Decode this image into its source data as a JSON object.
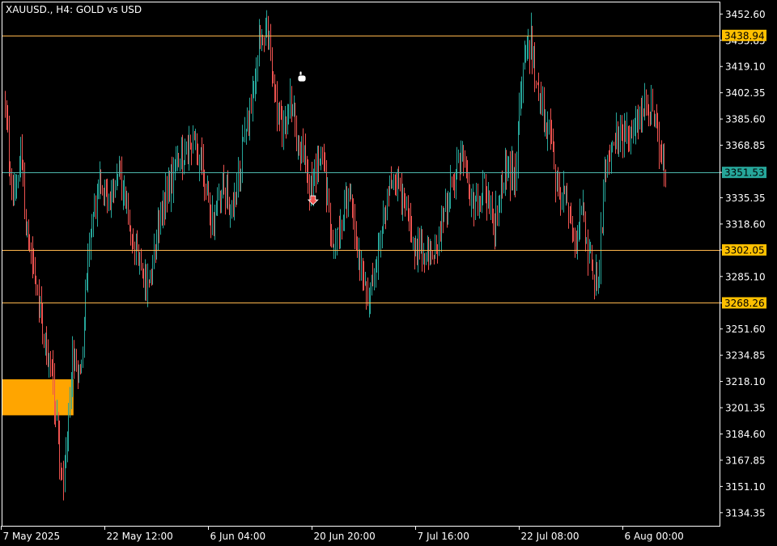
{
  "window": {
    "symbol_title": "XAUUSD., H4:  GOLD vs USD"
  },
  "colors": {
    "background": "#000000",
    "frame": "#ffffff",
    "bull": "#26a69a",
    "bear": "#ef5350",
    "level_line": "#ffb74d",
    "bid_line": "#4db6ac",
    "level_badge": "#ffc000",
    "bid_badge": "#26a69a",
    "zone": "#ffa500"
  },
  "chart_data": {
    "type": "candlestick",
    "ylim": [
      3126.0,
      3460.0
    ],
    "y_ticks": [
      "3452.60",
      "3435.85",
      "3419.10",
      "3402.35",
      "3385.60",
      "3368.85",
      "3351.53",
      "3335.35",
      "3318.60",
      "3302.05",
      "3285.10",
      "3268.26",
      "3251.60",
      "3234.85",
      "3218.10",
      "3201.35",
      "3184.60",
      "3167.85",
      "3151.10",
      "3134.35"
    ],
    "x_tick_labels": [
      "7 May 2025",
      "22 May 12:00",
      "6 Jun 04:00",
      "20 Jun 20:00",
      "7 Jul 16:00",
      "22 Jul 08:00",
      "6 Aug 00:00"
    ],
    "bar_count": 550,
    "x_tick_bar_index": [
      0,
      80,
      160,
      240,
      320,
      400,
      480
    ],
    "anchor_closes": [
      [
        0,
        3395
      ],
      [
        6,
        3330
      ],
      [
        12,
        3365
      ],
      [
        18,
        3302
      ],
      [
        24,
        3275
      ],
      [
        30,
        3248
      ],
      [
        35,
        3228
      ],
      [
        40,
        3192
      ],
      [
        44,
        3150
      ],
      [
        48,
        3178
      ],
      [
        52,
        3238
      ],
      [
        58,
        3218
      ],
      [
        64,
        3300
      ],
      [
        72,
        3342
      ],
      [
        80,
        3338
      ],
      [
        88,
        3352
      ],
      [
        96,
        3318
      ],
      [
        104,
        3295
      ],
      [
        112,
        3278
      ],
      [
        118,
        3318
      ],
      [
        126,
        3342
      ],
      [
        136,
        3362
      ],
      [
        144,
        3372
      ],
      [
        152,
        3360
      ],
      [
        160,
        3318
      ],
      [
        168,
        3345
      ],
      [
        176,
        3320
      ],
      [
        184,
        3370
      ],
      [
        190,
        3398
      ],
      [
        196,
        3435
      ],
      [
        202,
        3442
      ],
      [
        208,
        3402
      ],
      [
        214,
        3375
      ],
      [
        220,
        3398
      ],
      [
        228,
        3368
      ],
      [
        236,
        3342
      ],
      [
        244,
        3368
      ],
      [
        252,
        3312
      ],
      [
        258,
        3318
      ],
      [
        266,
        3335
      ],
      [
        272,
        3302
      ],
      [
        278,
        3275
      ],
      [
        284,
        3282
      ],
      [
        292,
        3328
      ],
      [
        300,
        3345
      ],
      [
        306,
        3338
      ],
      [
        314,
        3312
      ],
      [
        322,
        3300
      ],
      [
        330,
        3298
      ],
      [
        338,
        3318
      ],
      [
        346,
        3345
      ],
      [
        354,
        3362
      ],
      [
        362,
        3325
      ],
      [
        370,
        3342
      ],
      [
        378,
        3318
      ],
      [
        386,
        3352
      ],
      [
        394,
        3350
      ],
      [
        400,
        3422
      ],
      [
        406,
        3436
      ],
      [
        412,
        3398
      ],
      [
        420,
        3375
      ],
      [
        428,
        3338
      ],
      [
        434,
        3330
      ],
      [
        440,
        3305
      ],
      [
        446,
        3325
      ],
      [
        452,
        3292
      ],
      [
        458,
        3285
      ],
      [
        464,
        3360
      ],
      [
        472,
        3378
      ],
      [
        480,
        3372
      ],
      [
        488,
        3382
      ],
      [
        494,
        3395
      ],
      [
        500,
        3396
      ],
      [
        506,
        3365
      ],
      [
        510,
        3355
      ]
    ],
    "volatility": 9,
    "levels": [
      {
        "label": "3438.94",
        "value": 3438.94,
        "style": "level"
      },
      {
        "label": "3302.05",
        "value": 3302.05,
        "style": "level"
      },
      {
        "label": "3268.26",
        "value": 3268.26,
        "style": "level"
      }
    ],
    "bid": {
      "label": "3351.53",
      "value": 3351.53
    },
    "zones": [
      {
        "bar_start": 0,
        "bar_end": 53,
        "y_top": 3219.5,
        "y_bottom": 3196.5
      }
    ],
    "markers": [
      {
        "name": "sell-arrow",
        "bar": 238,
        "value": 3334
      }
    ]
  }
}
